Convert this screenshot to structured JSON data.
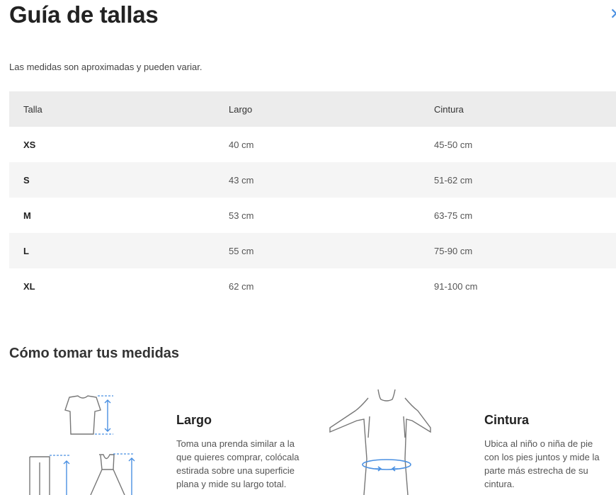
{
  "header": {
    "title": "Guía de tallas",
    "close_icon": "close-icon",
    "disclaimer": "Las medidas son aproximadas y pueden variar."
  },
  "table": {
    "columns": [
      "Talla",
      "Largo",
      "Cintura"
    ],
    "rows": [
      {
        "size": "XS",
        "largo": "40 cm",
        "cintura": "45-50 cm"
      },
      {
        "size": "S",
        "largo": "43 cm",
        "cintura": "51-62 cm"
      },
      {
        "size": "M",
        "largo": "53 cm",
        "cintura": "63-75 cm"
      },
      {
        "size": "L",
        "largo": "55 cm",
        "cintura": "75-90 cm"
      },
      {
        "size": "XL",
        "largo": "62 cm",
        "cintura": "91-100 cm"
      }
    ]
  },
  "howto": {
    "title": "Cómo tomar tus medidas",
    "largo": {
      "title": "Largo",
      "text_lines": [
        "Toma una prenda similar a la",
        "que quieres comprar, colócala",
        "estirada sobre una superficie",
        "plana y mide su largo total."
      ]
    },
    "cintura": {
      "title": "Cintura",
      "text_lines": [
        "Ubica al niño o niña de pie",
        "con los pies juntos y mide la",
        "parte más estrecha de su",
        "cintura."
      ]
    }
  },
  "colors": {
    "accent": "#4a90e2",
    "header_row": "#ececec",
    "alt_row": "#f5f5f5"
  }
}
